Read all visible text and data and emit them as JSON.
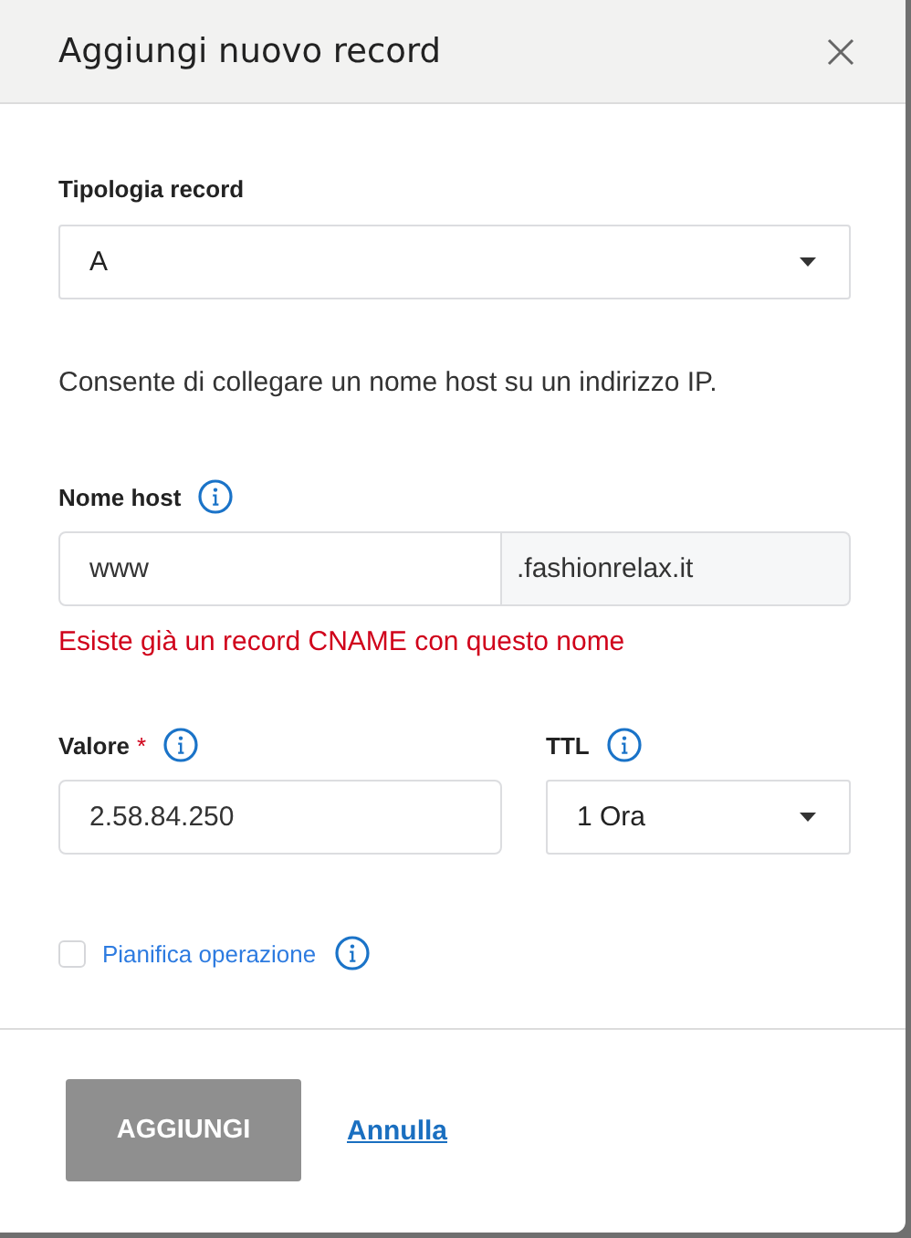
{
  "dialog": {
    "title": "Aggiungi nuovo record"
  },
  "record_type": {
    "label": "Tipologia record",
    "value": "A"
  },
  "description": "Consente di collegare un nome host su un indirizzo IP.",
  "host": {
    "label": "Nome host",
    "value": "www",
    "suffix": ".fashionrelax.it",
    "error": "Esiste già un record CNAME con questo nome"
  },
  "value": {
    "label": "Valore",
    "required_mark": "*",
    "value": "2.58.84.250"
  },
  "ttl": {
    "label": "TTL",
    "value": "1 Ora"
  },
  "schedule": {
    "label": "Pianifica operazione",
    "checked": false
  },
  "buttons": [
    {
      "label": "AGGIUNGI",
      "kind": "primary",
      "disabled": true
    },
    {
      "label": "Annulla",
      "kind": "link",
      "disabled": false
    }
  ]
}
